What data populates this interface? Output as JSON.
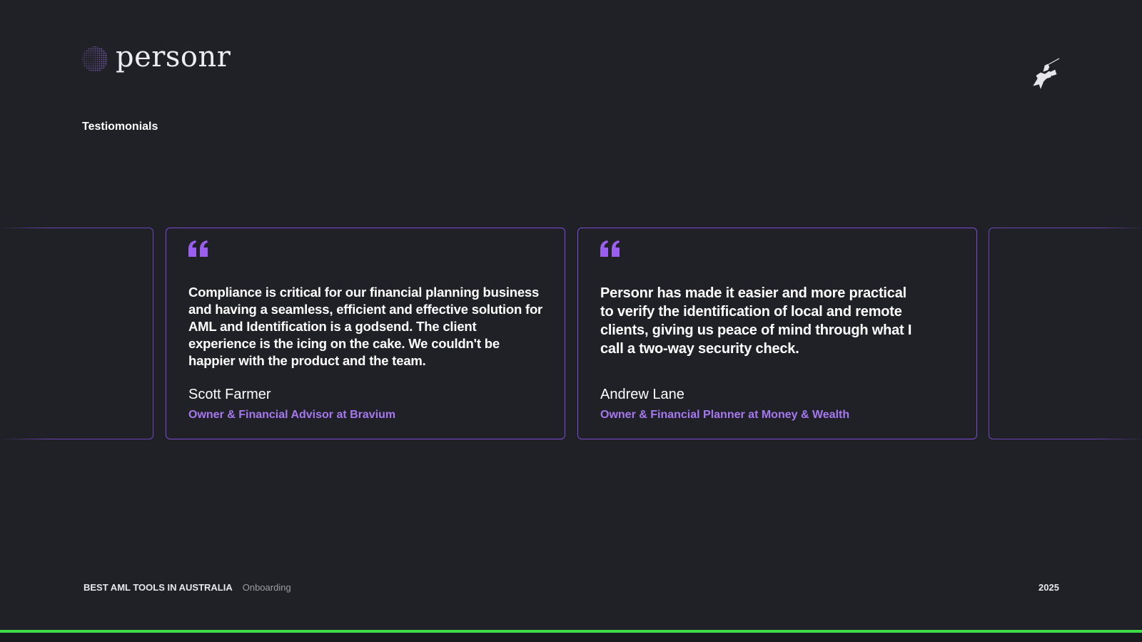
{
  "brand": {
    "name": "personr",
    "logo_icon": "dotted-sphere-icon",
    "mascot_icon": "knight-on-horse-icon"
  },
  "section_title": "Testiomonials",
  "testimonials": [
    {
      "quote": "Compliance is critical for our financial planning business and having a seamless, efficient and effective solution for AML and Identification is a godsend.  The client experience is the icing on the cake. We couldn't be happier with the product and the team.",
      "author": "Scott Farmer",
      "role": "Owner & Financial Advisor at Bravium"
    },
    {
      "quote": "Personr has made it easier and more practical to verify the identification of local and remote clients, giving us peace of mind through what I call a two-way security check.",
      "author": "Andrew Lane",
      "role": "Owner & Financial Planner at Money & Wealth"
    }
  ],
  "footer": {
    "brand": "BEST AML TOOLS IN AUSTRALIA",
    "section": "Onboarding",
    "year": "2025"
  },
  "colors": {
    "background": "#202126",
    "accent_purple": "#a678f0",
    "card_border": "#7a4bd6",
    "accent_bar": "#3fdc4c"
  }
}
